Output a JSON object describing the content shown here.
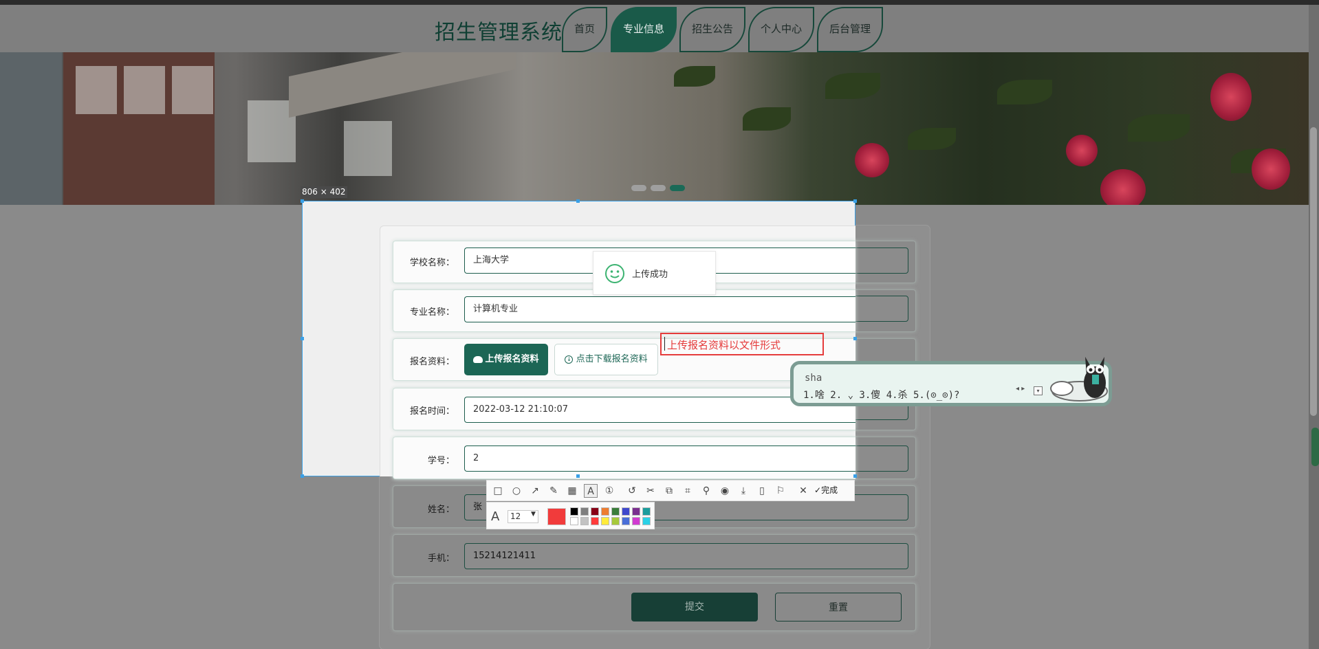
{
  "nav": {
    "site_title": "招生管理系统",
    "tabs": [
      {
        "label": "首页",
        "active": false
      },
      {
        "label": "专业信息",
        "active": true
      },
      {
        "label": "招生公告",
        "active": false
      },
      {
        "label": "个人中心",
        "active": false
      },
      {
        "label": "后台管理",
        "active": false
      }
    ]
  },
  "banner": {
    "slide_count": 3,
    "active_slide": 3
  },
  "form": {
    "school_label": "学校名称：",
    "school_value": "上海大学",
    "major_label": "专业名称：",
    "major_value": "计算机专业",
    "material_label": "报名资料：",
    "upload_button": "上传报名资料",
    "download_button": "点击下载报名资料",
    "time_label": "报名时间：",
    "time_value": "2022-03-12 21:10:07",
    "student_id_label": "学号：",
    "student_id_value": "2",
    "name_label": "姓名：",
    "name_value": "张",
    "phone_label": "手机：",
    "phone_value": "15214121411",
    "submit_button": "提交",
    "reset_button": "重置"
  },
  "toast": {
    "text": "上传成功",
    "icon": "smile-icon"
  },
  "screenshot_tool": {
    "selection_size": "806 × 402",
    "annotation_text": "上传报名资料以文件形式",
    "annotation_color": "#e53b3b",
    "done_label": "完成",
    "font_size": "12",
    "current_color": "#f13b3b",
    "palette": [
      "#000000",
      "#7f7f7f",
      "#880015",
      "#ed7d31",
      "#3a7d3a",
      "#3f48cc",
      "#7a2f8f",
      "#1a9c9c",
      "#ffffff",
      "#c3c3c3",
      "#ff3b3b",
      "#ffeb3b",
      "#a6c93b",
      "#4a6fd8",
      "#d13bd1",
      "#2ad1e6"
    ],
    "tools": [
      "rectangle-icon",
      "ellipse-icon",
      "arrow-icon",
      "pencil-icon",
      "mosaic-icon",
      "text-icon",
      "number-icon",
      "undo-icon",
      "cut-icon",
      "translate-icon",
      "ocr-icon",
      "pin-icon",
      "record-icon",
      "download-icon",
      "long-screenshot-icon",
      "bookmark-icon",
      "close-icon"
    ]
  },
  "ime": {
    "input": "sha",
    "candidates": "1.啥  2. ⌄  3.傻  4.杀  5.(⊙_⊙)?"
  }
}
